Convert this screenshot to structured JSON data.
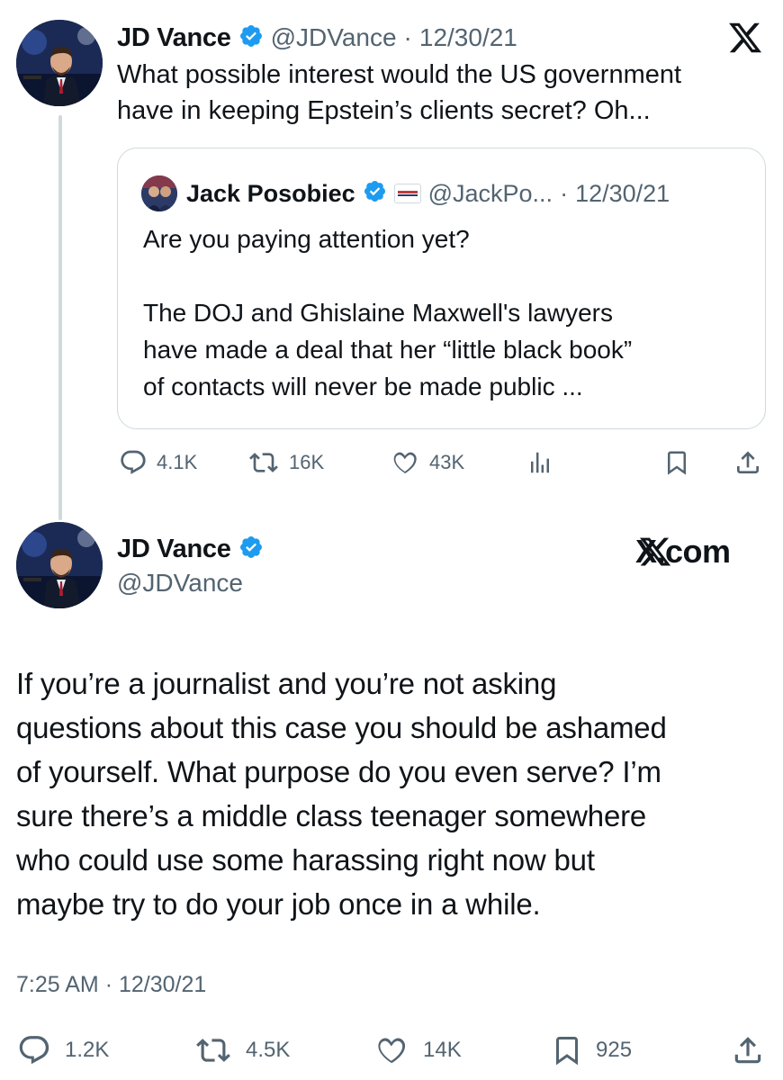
{
  "top_tweet": {
    "author_name": "JD Vance",
    "handle": "@JDVance",
    "separator": "·",
    "date": "12/30/21",
    "text_line1": "What possible interest would the US government",
    "text_line2": "have in keeping Epstein’s clients secret? Oh...",
    "platform_logo": "x-logo-icon"
  },
  "quoted_tweet": {
    "author_name": "Jack Posobiec",
    "handle": "@JackPo...",
    "separator": "·",
    "date": "12/30/21",
    "line1": "Are you paying attention yet?",
    "line2": "The DOJ and Ghislaine Maxwell's lawyers",
    "line3": "have made a deal that her “little black book”",
    "line4": "of contacts will never be made public ..."
  },
  "top_actions": {
    "replies": "4.1K",
    "reposts": "16K",
    "likes": "43K"
  },
  "main_tweet": {
    "author_name": "JD Vance",
    "handle": "@JDVance",
    "brand": "X.com",
    "lines": [
      "If you’re a journalist and you’re not asking",
      "questions about this case you should be ashamed",
      "of yourself. What purpose do you even serve? I’m",
      "sure there’s a middle class teenager somewhere",
      "who could use some harassing right now but",
      "maybe try to do your job once in a while."
    ],
    "time": "7:25 AM",
    "separator": "·",
    "date": "12/30/21"
  },
  "main_actions": {
    "replies": "1.2K",
    "reposts": "4.5K",
    "likes": "14K",
    "bookmarks": "925"
  },
  "colors": {
    "text": "#0f1419",
    "muted": "#536471",
    "verified": "#1d9bf0",
    "border": "#cfd9de"
  }
}
